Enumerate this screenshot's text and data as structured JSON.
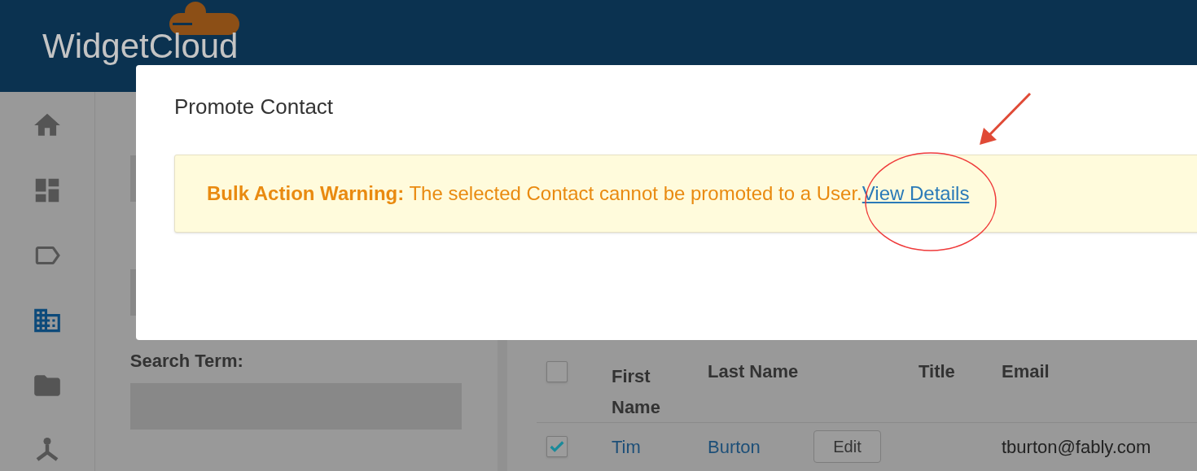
{
  "header": {
    "logo_text": "WidgetCloud"
  },
  "sidebar": {
    "items": [
      {
        "selected": false
      },
      {
        "selected": false
      },
      {
        "selected": false
      },
      {
        "selected": true
      },
      {
        "selected": false
      },
      {
        "selected": false
      }
    ]
  },
  "filters": [
    {
      "kind": "covered"
    },
    {
      "kind": "covered"
    },
    {
      "kind": "labeled",
      "label": "Search Term:"
    }
  ],
  "table": {
    "all_checked": false,
    "columns": [
      "First Name",
      "Last Name",
      "",
      "Title",
      "Email"
    ],
    "rows": [
      {
        "checked": true,
        "first_name": "Tim",
        "last_name": "Burton",
        "action": "Edit",
        "title": "",
        "email": "tburton@fably.com"
      }
    ]
  },
  "modal": {
    "title": "Promote Contact",
    "warning": {
      "lead": "Bulk Action Warning:",
      "text": "The selected Contact cannot be promoted to a User.",
      "link": "View Details"
    }
  }
}
